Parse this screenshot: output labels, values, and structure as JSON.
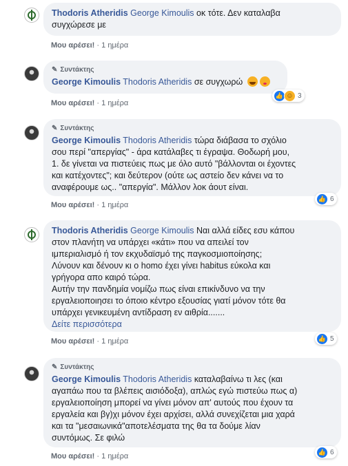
{
  "common": {
    "like_label": "Μου αρέσει!",
    "sep": "·",
    "author_badge": "Συντάκτης"
  },
  "comments": [
    {
      "author": "Thodoris Atheridis",
      "mention": "George Kimoulis",
      "text": "οκ τότε. Δεν καταλαβα",
      "text2": "συγχώρεσε με",
      "time": "1 ημέρα"
    },
    {
      "author": "George Kimoulis",
      "mention": "Thodoris Atheridis",
      "text": "σε συγχωρώ",
      "time": "1 ημέρα",
      "reactions": "3"
    },
    {
      "author": "George Kimoulis",
      "mention": "Thodoris Atheridis",
      "line1": "τώρα διάβασα το σχόλιο",
      "line2": "σου περί \"απεργίας\" - άρα κατάλαβες τι έγραψα. Θοδωρή μου,",
      "line3": "1. δε γίνεται να πιστεύεις πως με όλο αυτό \"βάλλονται οι έχοντες",
      "line4": "και κατέχοντες\"; και δεύτερον (ούτε ως αστείο δεν κάνει να το",
      "line5": "αναφέρουμε ως.. \"απεργία\". Μάλλον λοκ άουτ είναι.",
      "time": "1 ημέρα",
      "reactions": "6"
    },
    {
      "author": "Thodoris Atheridis",
      "mention": "George Kimoulis",
      "line1": "Ναι αλλά είδες εσυ κάπου",
      "line2": "στον πλανήτη να υπάρχει «κάτι» που να απειλεί τον",
      "line3": "ιμπεριαλισμό ή τον εκχυδαϊσμό της παγκοσμιοποίησης;",
      "line4": "Λύνουν και δένουν κι ο homo έχει γίνει habitus εύκολα και",
      "line5": "γρήγορα απο καιρό τώρα.",
      "line6": "Αυτήν την πανδημία νομίζω πως είναι επικίνδυνο να την",
      "line7": "εργαλειοποιησει το όποιο κέντρο εξουσίας γιατί μόνον τότε θα",
      "line8": "υπάρχει γενικευμένη αντίδραση εν αιθρία.......",
      "see_more": "Δείτε περισσότερα",
      "time": "1 ημέρα",
      "reactions": "5"
    },
    {
      "author": "George Kimoulis",
      "mention": "Thodoris Atheridis",
      "line1": "καταλαβαίνω τι λες (και",
      "line2": "αγαπάω που τα βλέπεις αισιόδοξα), απλώς εγώ πιστεύω πως α)",
      "line3": "εργαλειοποίηση μπορεί να γίνει μόνον απ' αυτούς που έχουν τα",
      "line4": "εργαλεία και βγ)χι μόνον έχει αρχίσει, αλλά συνεχίζεται μια χαρά",
      "line5": "και τα \"μεσαιωνικά\"αποτελέσματα της θα τα δούμε λίαν",
      "line6": "συντόμως. Σε φιλώ",
      "time": "1 ημέρα",
      "reactions": "6"
    }
  ]
}
